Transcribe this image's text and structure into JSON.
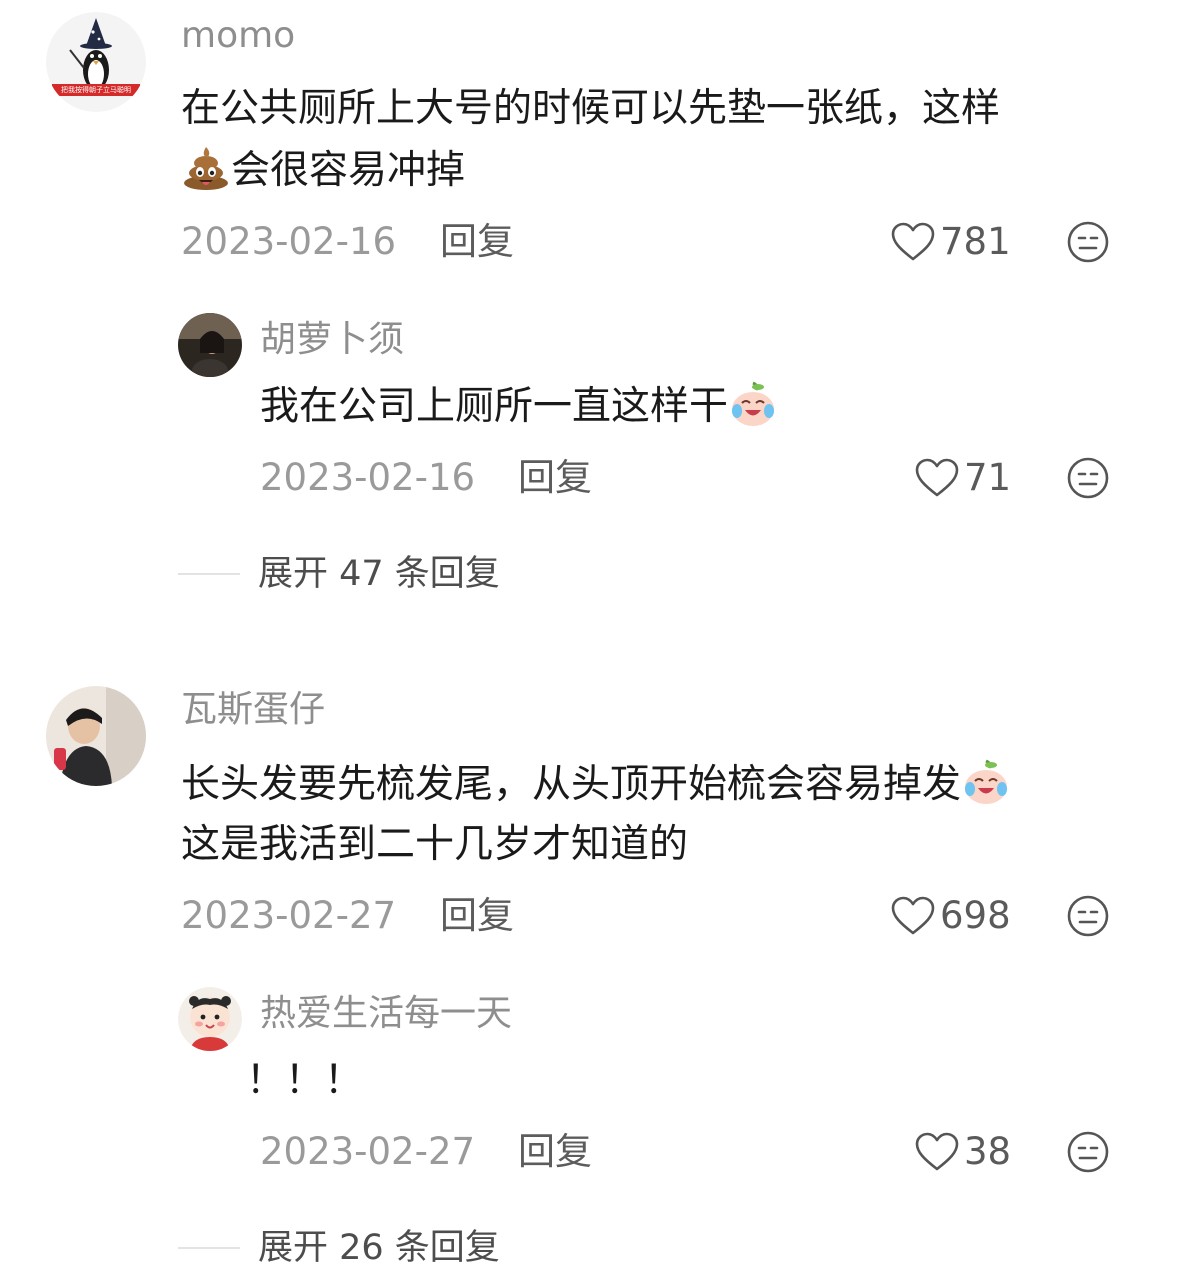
{
  "comments": [
    {
      "username": "momo",
      "avatar_badge_text": "把我按得朝子立马聪明",
      "text_line1": "在公共厕所上大号的时候可以先垫一张纸，这样",
      "text_line2_emoji": "poop-emoji",
      "text_line2": "会很容易冲掉",
      "date": "2023-02-16",
      "reply_label": "回复",
      "likes": "781",
      "replies": [
        {
          "username": "胡萝卜须",
          "text": "我在公司上厕所一直这样干",
          "text_emoji": "crying-laugh-peach-emoji",
          "date": "2023-02-16",
          "reply_label": "回复",
          "likes": "71"
        }
      ],
      "expand_label": "展开 47 条回复"
    },
    {
      "username": "瓦斯蛋仔",
      "text_line1": "长头发要先梳发尾，从头顶开始梳会容易掉发",
      "text_line1_emoji": "crying-laugh-peach-emoji",
      "text_line2": "这是我活到二十几岁才知道的",
      "date": "2023-02-27",
      "reply_label": "回复",
      "likes": "698",
      "replies": [
        {
          "username": "热爱生活每一天",
          "text": "！！！",
          "date": "2023-02-27",
          "reply_label": "回复",
          "likes": "38"
        }
      ],
      "expand_label": "展开 26 条回复"
    }
  ],
  "icons": {
    "like": "heart-outline-icon",
    "dislike": "neutral-face-icon"
  },
  "colors": {
    "text": "#1a1a1a",
    "muted": "#9a9a9a",
    "username": "#8e8e8e"
  }
}
